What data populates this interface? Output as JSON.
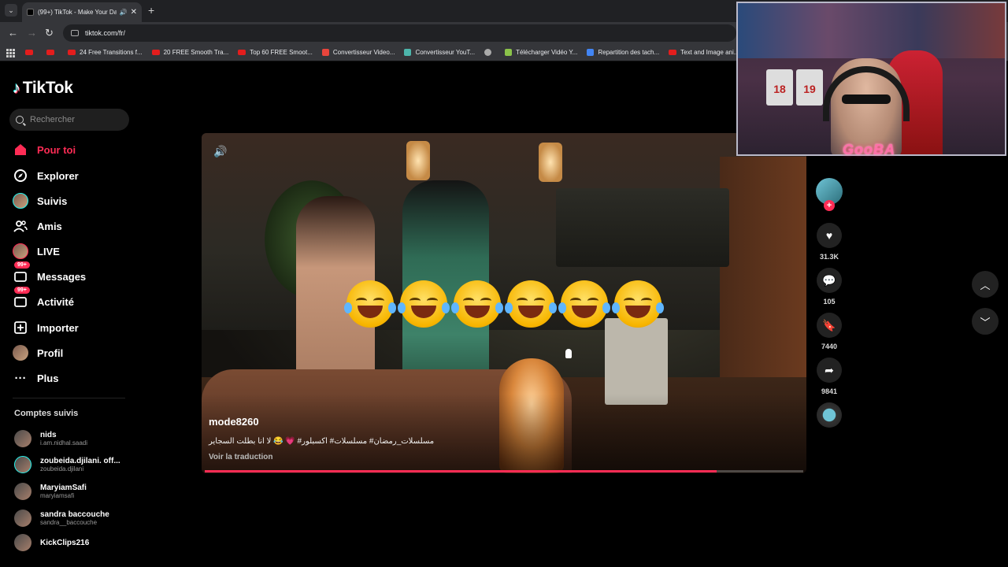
{
  "browser": {
    "tab_title": "(99+) TikTok - Make Your Da",
    "url": "tiktok.com/fr/",
    "new_tab": "+",
    "bookmarks": [
      {
        "label": "",
        "type": "yt"
      },
      {
        "label": "",
        "type": "yt"
      },
      {
        "label": "24 Free Transitions f...",
        "type": "yt"
      },
      {
        "label": "20 FREE Smooth Tra...",
        "type": "yt"
      },
      {
        "label": "Top 60 FREE Smoot...",
        "type": "yt"
      },
      {
        "label": "Convertisseur Video...",
        "type": "z"
      },
      {
        "label": "Convertisseur YouT...",
        "type": "conv"
      },
      {
        "label": "",
        "type": "globe"
      },
      {
        "label": "Télécharger Vidéo Y...",
        "type": "dl"
      },
      {
        "label": "Repartition des tach...",
        "type": "doc"
      },
      {
        "label": "Text and Image ani...",
        "type": "yt"
      }
    ]
  },
  "brand": {
    "name": "TikTok"
  },
  "search": {
    "placeholder": "Rechercher"
  },
  "nav": {
    "for_you": "Pour toi",
    "explore": "Explorer",
    "following": "Suivis",
    "friends": "Amis",
    "live": "LIVE",
    "messages": "Messages",
    "messages_badge": "99+",
    "activity": "Activité",
    "activity_badge": "99+",
    "upload": "Importer",
    "profile": "Profil",
    "more": "Plus"
  },
  "following_title": "Comptes suivis",
  "accounts": [
    {
      "name": "nids",
      "handle": "i.am.nidhal.saadi"
    },
    {
      "name": "zoubeida.djilani. off...",
      "handle": "zoubeida.djilani"
    },
    {
      "name": "MaryiamSafi",
      "handle": "maryiamsafi"
    },
    {
      "name": "sandra baccouche",
      "handle": "sandra__baccouche"
    },
    {
      "name": "KickClips216",
      "handle": ""
    }
  ],
  "video": {
    "author": "mode8260",
    "caption": "مسلسلات_رمضان# مسلسلات# اكسبلور# 💗 😂 لا انا بطلت السجاير",
    "translate": "Voir la traduction",
    "emoji_count": 6,
    "progress": 0.855
  },
  "actions": {
    "likes": "31.3K",
    "comments": "105",
    "saves": "7440",
    "shares": "9841"
  },
  "overlay": {
    "streamer_name": "GooBA",
    "jersey_left": "18",
    "jersey_right": "19"
  },
  "colors": {
    "accent": "#fe2c55",
    "background": "#000000"
  }
}
